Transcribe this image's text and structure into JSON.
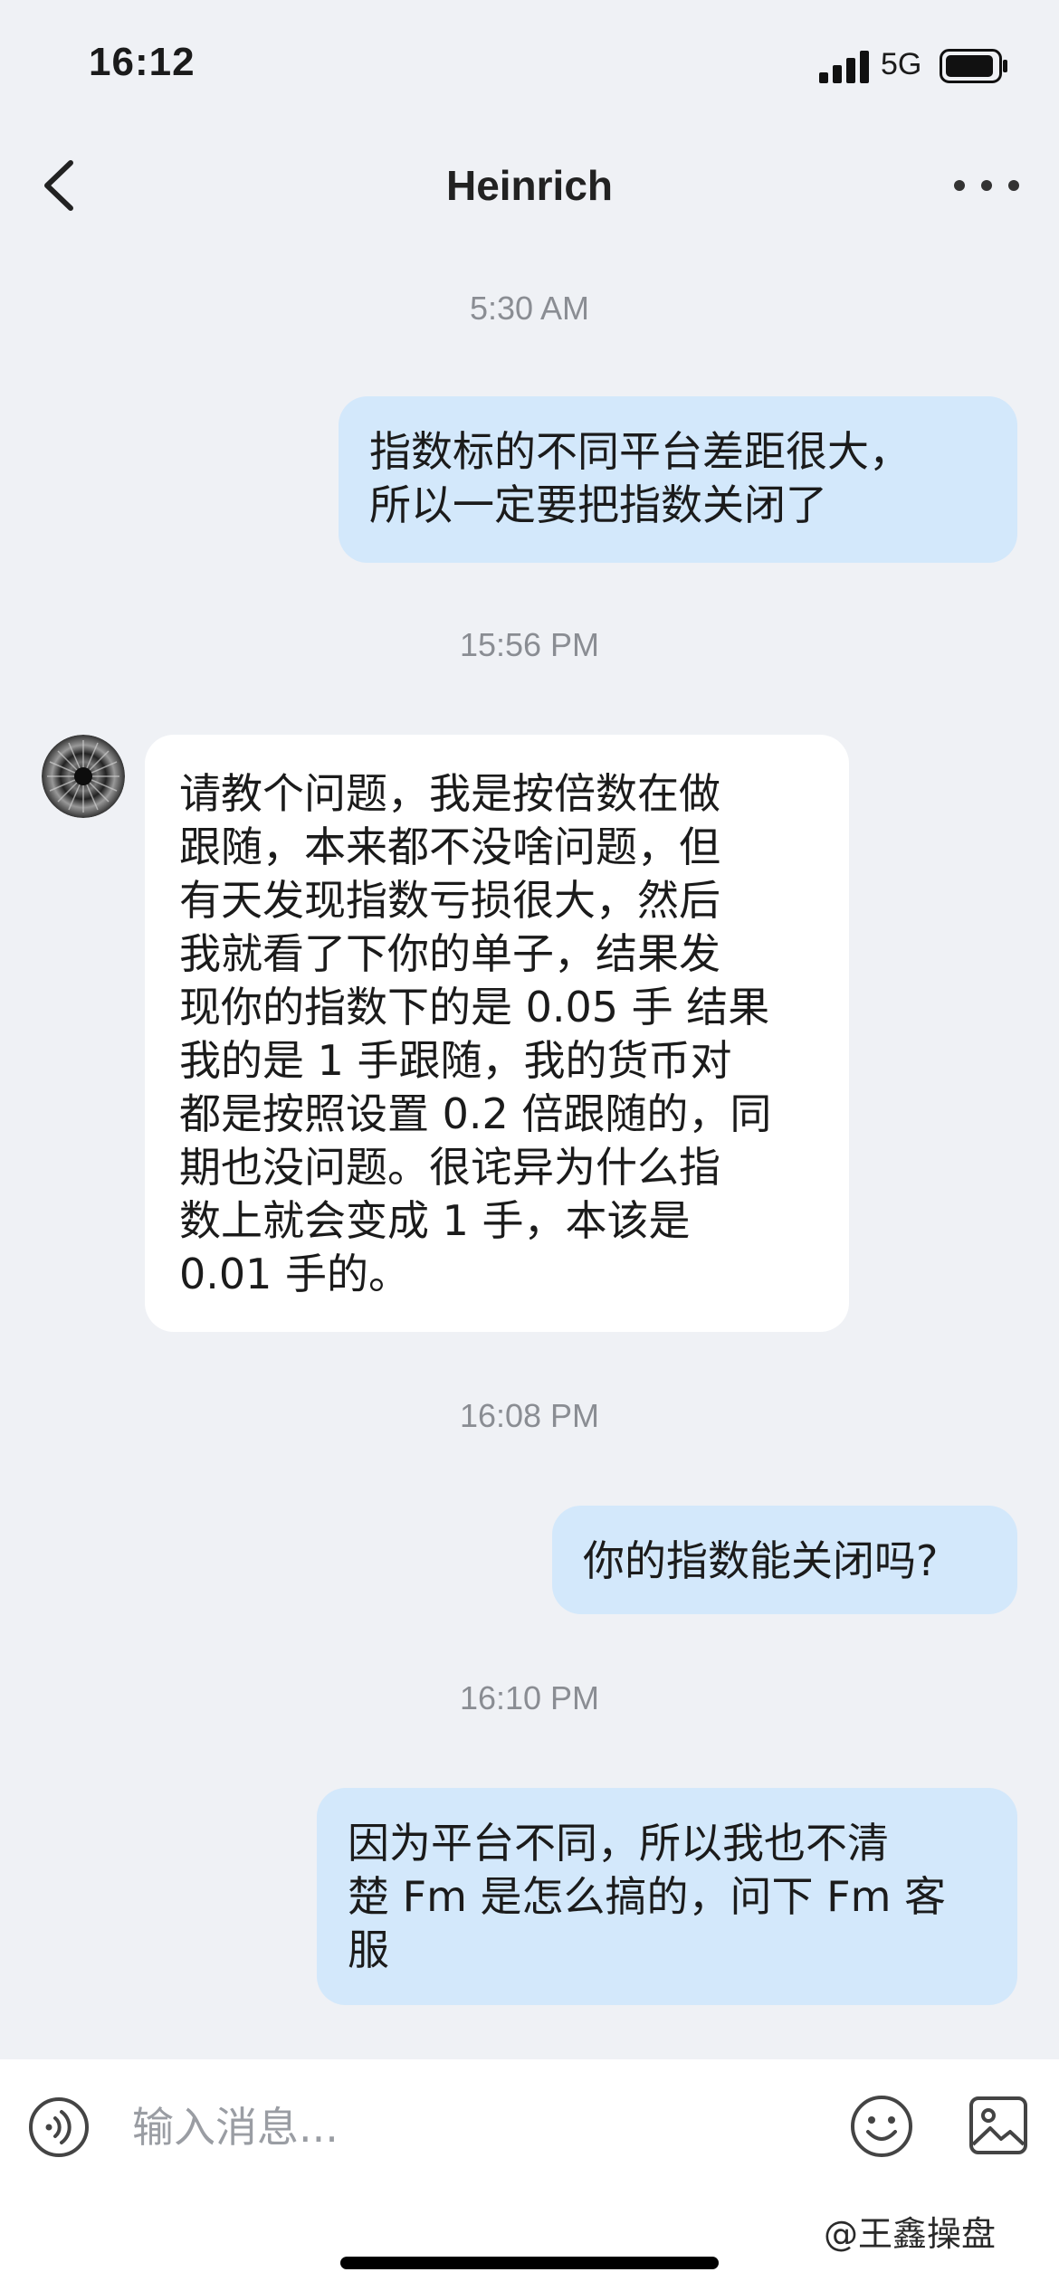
{
  "status_bar": {
    "time": "16:12",
    "network": "5G"
  },
  "header": {
    "title": "Heinrich",
    "back_icon": "chevron-left-icon",
    "more_icon": "more-dots-icon"
  },
  "messages": [
    {
      "type": "timestamp",
      "text": "5:30 AM"
    },
    {
      "type": "outgoing",
      "text": "指数标的不同平台差距很大，\n所以一定要把指数关闭了"
    },
    {
      "type": "timestamp",
      "text": "15:56 PM"
    },
    {
      "type": "incoming",
      "text": "请教个问题，我是按倍数在做\n跟随，本来都不没啥问题，但\n有天发现指数亏损很大，然后\n我就看了下你的单子，结果发\n现你的指数下的是 0.05 手 结果\n我的是 1 手跟随，我的货币对\n都是按照设置 0.2 倍跟随的，同\n期也没问题。很诧异为什么指\n数上就会变成 1 手，本该是\n0.01 手的。"
    },
    {
      "type": "timestamp",
      "text": "16:08 PM"
    },
    {
      "type": "outgoing",
      "text": "你的指数能关闭吗?"
    },
    {
      "type": "timestamp",
      "text": "16:10 PM"
    },
    {
      "type": "outgoing",
      "text": "因为平台不同，所以我也不清\n楚 Fm 是怎么搞的，问下 Fm 客\n服"
    }
  ],
  "input_bar": {
    "placeholder": "输入消息...",
    "voice_icon": "voice-wave-icon",
    "emoji_icon": "emoji-icon",
    "image_icon": "image-icon"
  },
  "watermark": "@王鑫操盘",
  "colors": {
    "background": "#eff1f5",
    "outgoing_bubble": "#d3e8fb",
    "incoming_bubble": "#ffffff",
    "timestamp_text": "#8a8d93"
  }
}
